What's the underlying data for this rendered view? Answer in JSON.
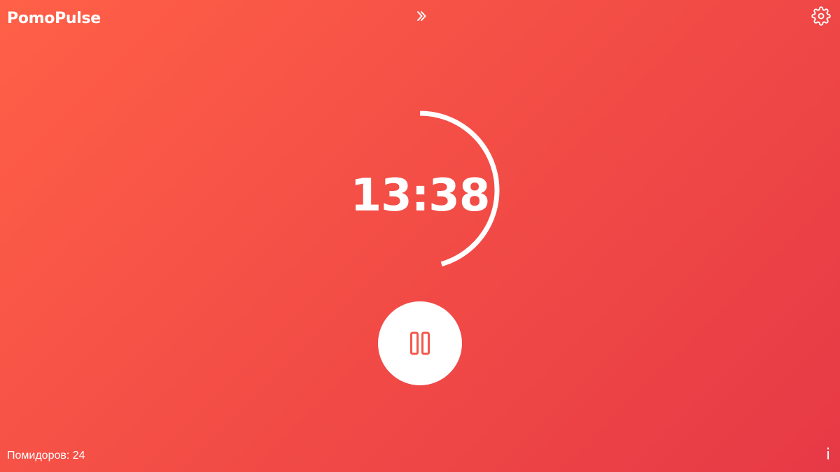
{
  "app": {
    "title": "PomoPulse"
  },
  "toolbar": {
    "skip_icon": "double-chevron-right-icon",
    "settings_icon": "gear-icon"
  },
  "timer": {
    "time_remaining": "13:38",
    "progress_fraction": 0.455,
    "ring_color": "#ffffff"
  },
  "controls": {
    "play_pause_icon": "pause-icon",
    "icon_color": "#f4574a"
  },
  "footer": {
    "pomodoro_count": "Помидоров: 24",
    "info_label": "i"
  },
  "theme": {
    "gradient_start": "#ff6047",
    "gradient_end": "#e63946"
  }
}
